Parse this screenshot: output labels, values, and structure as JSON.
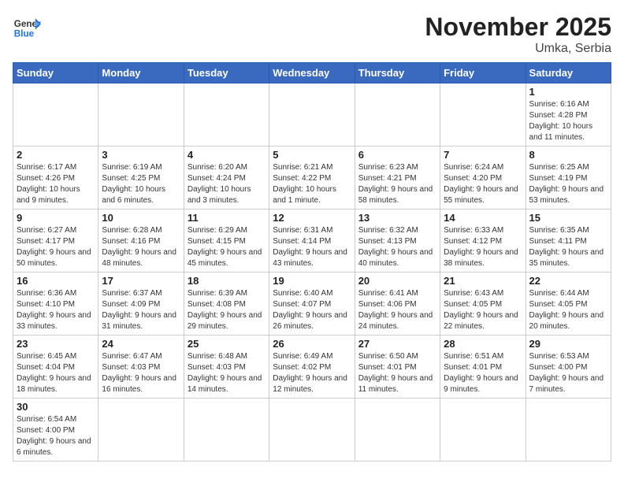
{
  "header": {
    "logo_general": "General",
    "logo_blue": "Blue",
    "month_title": "November 2025",
    "location": "Umka, Serbia"
  },
  "weekdays": [
    "Sunday",
    "Monday",
    "Tuesday",
    "Wednesday",
    "Thursday",
    "Friday",
    "Saturday"
  ],
  "days": {
    "1": {
      "sunrise": "6:16 AM",
      "sunset": "4:28 PM",
      "daylight": "10 hours and 11 minutes."
    },
    "2": {
      "sunrise": "6:17 AM",
      "sunset": "4:26 PM",
      "daylight": "10 hours and 9 minutes."
    },
    "3": {
      "sunrise": "6:19 AM",
      "sunset": "4:25 PM",
      "daylight": "10 hours and 6 minutes."
    },
    "4": {
      "sunrise": "6:20 AM",
      "sunset": "4:24 PM",
      "daylight": "10 hours and 3 minutes."
    },
    "5": {
      "sunrise": "6:21 AM",
      "sunset": "4:22 PM",
      "daylight": "10 hours and 1 minute."
    },
    "6": {
      "sunrise": "6:23 AM",
      "sunset": "4:21 PM",
      "daylight": "9 hours and 58 minutes."
    },
    "7": {
      "sunrise": "6:24 AM",
      "sunset": "4:20 PM",
      "daylight": "9 hours and 55 minutes."
    },
    "8": {
      "sunrise": "6:25 AM",
      "sunset": "4:19 PM",
      "daylight": "9 hours and 53 minutes."
    },
    "9": {
      "sunrise": "6:27 AM",
      "sunset": "4:17 PM",
      "daylight": "9 hours and 50 minutes."
    },
    "10": {
      "sunrise": "6:28 AM",
      "sunset": "4:16 PM",
      "daylight": "9 hours and 48 minutes."
    },
    "11": {
      "sunrise": "6:29 AM",
      "sunset": "4:15 PM",
      "daylight": "9 hours and 45 minutes."
    },
    "12": {
      "sunrise": "6:31 AM",
      "sunset": "4:14 PM",
      "daylight": "9 hours and 43 minutes."
    },
    "13": {
      "sunrise": "6:32 AM",
      "sunset": "4:13 PM",
      "daylight": "9 hours and 40 minutes."
    },
    "14": {
      "sunrise": "6:33 AM",
      "sunset": "4:12 PM",
      "daylight": "9 hours and 38 minutes."
    },
    "15": {
      "sunrise": "6:35 AM",
      "sunset": "4:11 PM",
      "daylight": "9 hours and 35 minutes."
    },
    "16": {
      "sunrise": "6:36 AM",
      "sunset": "4:10 PM",
      "daylight": "9 hours and 33 minutes."
    },
    "17": {
      "sunrise": "6:37 AM",
      "sunset": "4:09 PM",
      "daylight": "9 hours and 31 minutes."
    },
    "18": {
      "sunrise": "6:39 AM",
      "sunset": "4:08 PM",
      "daylight": "9 hours and 29 minutes."
    },
    "19": {
      "sunrise": "6:40 AM",
      "sunset": "4:07 PM",
      "daylight": "9 hours and 26 minutes."
    },
    "20": {
      "sunrise": "6:41 AM",
      "sunset": "4:06 PM",
      "daylight": "9 hours and 24 minutes."
    },
    "21": {
      "sunrise": "6:43 AM",
      "sunset": "4:05 PM",
      "daylight": "9 hours and 22 minutes."
    },
    "22": {
      "sunrise": "6:44 AM",
      "sunset": "4:05 PM",
      "daylight": "9 hours and 20 minutes."
    },
    "23": {
      "sunrise": "6:45 AM",
      "sunset": "4:04 PM",
      "daylight": "9 hours and 18 minutes."
    },
    "24": {
      "sunrise": "6:47 AM",
      "sunset": "4:03 PM",
      "daylight": "9 hours and 16 minutes."
    },
    "25": {
      "sunrise": "6:48 AM",
      "sunset": "4:03 PM",
      "daylight": "9 hours and 14 minutes."
    },
    "26": {
      "sunrise": "6:49 AM",
      "sunset": "4:02 PM",
      "daylight": "9 hours and 12 minutes."
    },
    "27": {
      "sunrise": "6:50 AM",
      "sunset": "4:01 PM",
      "daylight": "9 hours and 11 minutes."
    },
    "28": {
      "sunrise": "6:51 AM",
      "sunset": "4:01 PM",
      "daylight": "9 hours and 9 minutes."
    },
    "29": {
      "sunrise": "6:53 AM",
      "sunset": "4:00 PM",
      "daylight": "9 hours and 7 minutes."
    },
    "30": {
      "sunrise": "6:54 AM",
      "sunset": "4:00 PM",
      "daylight": "9 hours and 6 minutes."
    }
  }
}
